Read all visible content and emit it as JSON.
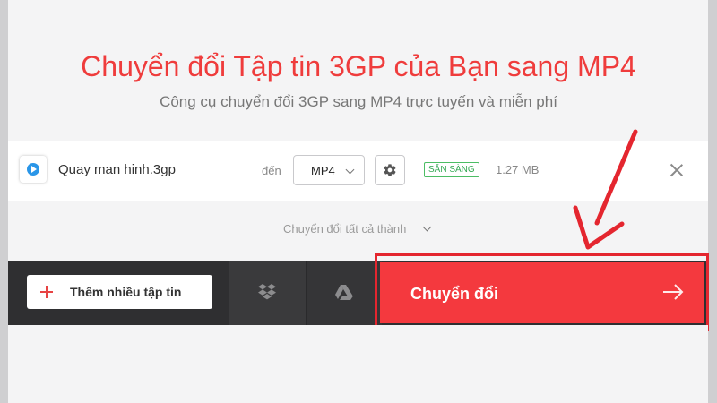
{
  "header": {
    "title": "Chuyển đổi Tập tin 3GP của Bạn sang MP4",
    "subtitle": "Công cụ chuyển đổi 3GP sang MP4 trực tuyến và miễn phí"
  },
  "file": {
    "icon": "play-circle-icon",
    "name": "Quay man hinh.3gp",
    "to_label": "đến",
    "format": "MP4",
    "status": "SẴN SÀNG",
    "size": "1.27 MB"
  },
  "convert_all": {
    "label": "Chuyển đổi tất cả thành"
  },
  "actions": {
    "add_label": "Thêm nhiều tập tin",
    "convert_label": "Chuyển đổi",
    "icons": [
      "plus-icon",
      "dropbox-icon",
      "google-drive-icon",
      "arrow-right-icon"
    ]
  },
  "colors": {
    "accent": "#f4393e",
    "title": "#ef3c3c",
    "status_green": "#34a853",
    "annotation_red": "#e4262f",
    "dark_bar": "#2f2f31"
  },
  "annotation": {
    "type": "red-arrow-and-box",
    "target": "convert-button"
  }
}
